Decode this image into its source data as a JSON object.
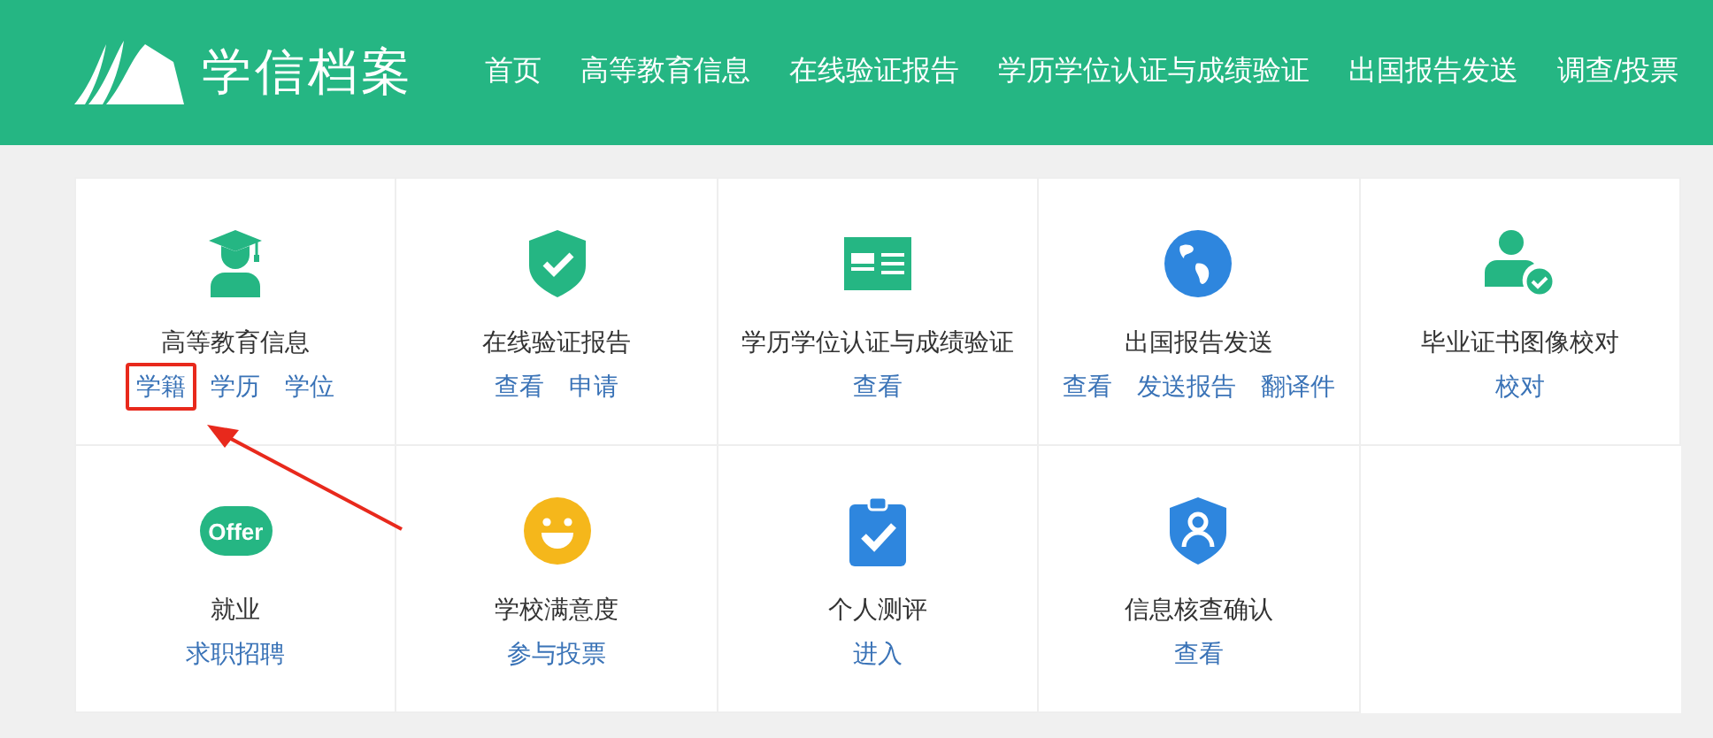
{
  "header": {
    "logo_text": "学信档案",
    "nav": [
      "首页",
      "高等教育信息",
      "在线验证报告",
      "学历学位认证与成绩验证",
      "出国报告发送",
      "调查/投票"
    ]
  },
  "services": [
    {
      "kind": "graduate",
      "title": "高等教育信息",
      "links": [
        {
          "label": "学籍",
          "highlighted": true
        },
        {
          "label": "学历",
          "highlighted": false
        },
        {
          "label": "学位",
          "highlighted": false
        }
      ]
    },
    {
      "kind": "shield-check",
      "title": "在线验证报告",
      "links": [
        {
          "label": "查看",
          "highlighted": false
        },
        {
          "label": "申请",
          "highlighted": false
        }
      ]
    },
    {
      "kind": "id-card",
      "title": "学历学位认证与成绩验证",
      "links": [
        {
          "label": "查看",
          "highlighted": false
        }
      ]
    },
    {
      "kind": "globe",
      "title": "出国报告发送",
      "links": [
        {
          "label": "查看",
          "highlighted": false
        },
        {
          "label": "发送报告",
          "highlighted": false
        },
        {
          "label": "翻译件",
          "highlighted": false
        }
      ]
    },
    {
      "kind": "user-check",
      "title": "毕业证书图像校对",
      "links": [
        {
          "label": "校对",
          "highlighted": false
        }
      ]
    },
    {
      "kind": "offer",
      "icon_text": "Offer",
      "title": "就业",
      "links": [
        {
          "label": "求职招聘",
          "highlighted": false
        }
      ]
    },
    {
      "kind": "smile",
      "title": "学校满意度",
      "links": [
        {
          "label": "参与投票",
          "highlighted": false
        }
      ]
    },
    {
      "kind": "clipboard-check",
      "title": "个人测评",
      "links": [
        {
          "label": "进入",
          "highlighted": false
        }
      ]
    },
    {
      "kind": "user-shield",
      "title": "信息核查确认",
      "links": [
        {
          "label": "查看",
          "highlighted": false
        }
      ]
    }
  ]
}
